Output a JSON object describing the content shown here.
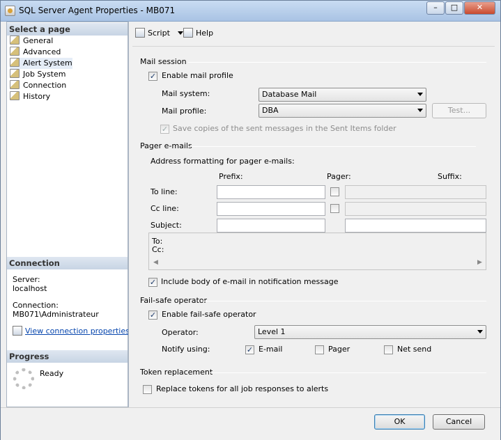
{
  "window": {
    "title": "SQL Server Agent Properties - MB071",
    "minimize": "–",
    "maximize": "□",
    "close": "✕"
  },
  "left": {
    "select_page_header": "Select a page",
    "pages": [
      {
        "label": "General"
      },
      {
        "label": "Advanced"
      },
      {
        "label": "Alert System",
        "selected": true
      },
      {
        "label": "Job System"
      },
      {
        "label": "Connection"
      },
      {
        "label": "History"
      }
    ],
    "connection_header": "Connection",
    "server_label": "Server:",
    "server_value": "localhost",
    "connection_label": "Connection:",
    "connection_value": "MB071\\Administrateur",
    "view_props_link": "View connection properties",
    "progress_header": "Progress",
    "progress_status": "Ready"
  },
  "toolbar": {
    "script_label": "Script",
    "help_label": "Help"
  },
  "mail": {
    "group_title": "Mail session",
    "enable_label": "Enable mail profile",
    "enable_checked": true,
    "system_label": "Mail system:",
    "system_value": "Database Mail",
    "profile_label": "Mail profile:",
    "profile_value": "DBA",
    "test_button": "Test...",
    "save_copies_label": "Save copies of the sent messages in the Sent Items folder",
    "save_copies_checked": true
  },
  "pager": {
    "group_title": "Pager e-mails",
    "address_label": "Address formatting for pager e-mails:",
    "prefix_header": "Prefix:",
    "pager_header": "Pager:",
    "suffix_header": "Suffix:",
    "to_line_label": "To line:",
    "cc_line_label": "Cc line:",
    "subject_label": "Subject:",
    "preview_to": "To:",
    "preview_cc": "Cc:",
    "include_body_label": "Include body of e-mail in notification message",
    "include_body_checked": true
  },
  "failsafe": {
    "group_title": "Fail-safe operator",
    "enable_label": "Enable fail-safe operator",
    "enable_checked": true,
    "operator_label": "Operator:",
    "operator_value": "Level 1",
    "notify_label": "Notify using:",
    "email_label": "E-mail",
    "email_checked": true,
    "pager_label": "Pager",
    "pager_checked": false,
    "netsend_label": "Net send",
    "netsend_checked": false
  },
  "token": {
    "group_title": "Token replacement",
    "replace_label": "Replace tokens for all job responses to alerts",
    "replace_checked": false
  },
  "buttons": {
    "ok": "OK",
    "cancel": "Cancel"
  }
}
